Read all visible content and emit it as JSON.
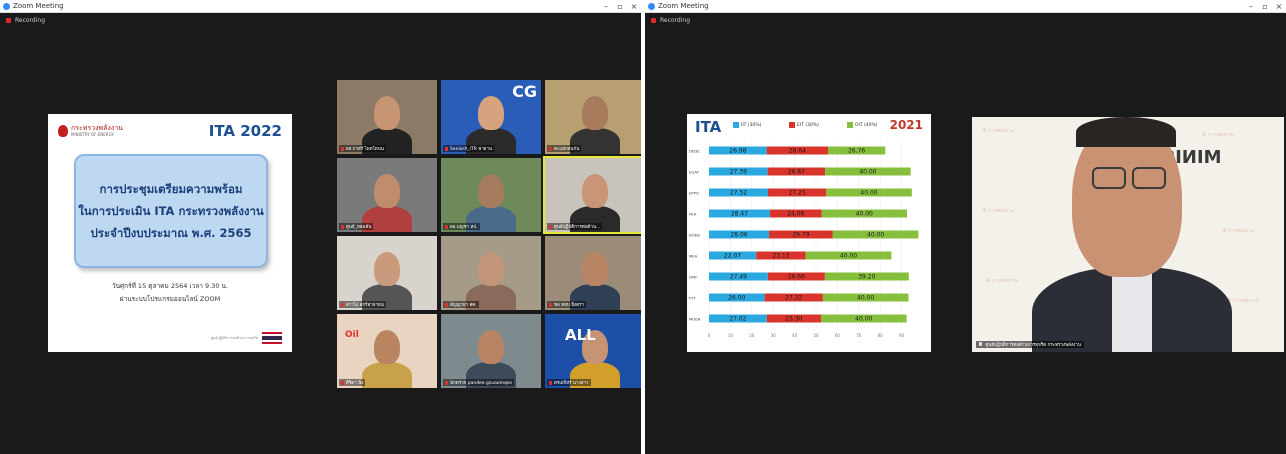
{
  "left_window": {
    "title": "Zoom Meeting",
    "recording": "Recording",
    "slide": {
      "ministry_th": "กระทรวงพลังงาน",
      "ministry_en": "MINISTRY OF ENERGY",
      "ita_label": "ITA 2022",
      "title_lines": [
        "การประชุมเตรียมความพร้อม",
        "ในการประเมิน ITA กระทรวงพลังงาน",
        "ประจำปีงบประมาณ พ.ศ. 2565"
      ],
      "date_line": "วันศุกร์ที่ 15 ตุลาคม 2564  เวลา 9.30 น.",
      "via_line": "ผ่านระบบโปรแกรมออนไลน์ ZOOM",
      "footer": "ศูนย์ปฏิบัติการต่อต้านการทุจริต"
    },
    "participants": [
      {
        "name": "ผอ.กาสร์ ไผทโตนน",
        "bg": "#8a7a66",
        "skin": "#c89574",
        "shirt": "#222222"
      },
      {
        "name": "SeniorA_ITR พ่ายาน",
        "bg": "#2a5db8",
        "skin": "#d7a37e",
        "shirt": "#2b2b2b",
        "overlay": "CG"
      },
      {
        "name": "ตะแลกอนกัน",
        "bg": "#b79f72",
        "skin": "#a77b5c",
        "shirt": "#333333"
      },
      {
        "name": "ศูนย์_ทอมสัน",
        "bg": "#7a7a7a",
        "skin": "#c08d6c",
        "shirt": "#b04040"
      },
      {
        "name": "ผอ.บญชา สป.",
        "bg": "#6e8a5a",
        "skin": "#a47b5d",
        "shirt": "#4a6a8a"
      },
      {
        "name": "ศูนย์ปฏิบัติการต่อต้าน...",
        "bg": "#c9c4bb",
        "skin": "#c99577",
        "shirt": "#2a2a2a",
        "active": true
      },
      {
        "name": "สาวไง สกร้อาจาธน",
        "bg": "#d8d3cd",
        "skin": "#c99b7c",
        "shirt": "#555555"
      },
      {
        "name": "สัญญายา สค.",
        "bg": "#a69a88",
        "skin": "#c3957a",
        "shirt": "#8a6a5a"
      },
      {
        "name": "ชล ทอบ ฮิ่งตรา",
        "bg": "#9a8c78",
        "skin": "#b78564",
        "shirt": "#2f3f55"
      },
      {
        "name": "ศิริดา นิ่ง",
        "bg": "#e8d4c0",
        "skin": "#b98460",
        "shirt": "#c8a14a",
        "overlay": "Oil"
      },
      {
        "name": "นักตรวจ pandee gsuaomqes",
        "bg": "#7e8a8e",
        "skin": "#b78563",
        "shirt": "#3c4a5a"
      },
      {
        "name": "ดรเอกิสร์ นางสาว",
        "bg": "#1e4fa8",
        "skin": "#c69475",
        "shirt": "#d2a02a",
        "overlay": "ALL"
      }
    ]
  },
  "right_window": {
    "title": "Zoom Meeting",
    "recording": "Recording",
    "window_controls": [
      "–",
      "▫",
      "×"
    ],
    "speaker_name": "ศูนย์ปฏิบัติการต่อต้านการทุจริต กระทรวงพลังงาน",
    "chart_data": {
      "type": "bar",
      "title": "ITA",
      "year_label": "2021",
      "stacked": true,
      "orientation": "horizontal",
      "categories": [
        "DEDE",
        "EGAT",
        "EPPO",
        "PEA",
        "DOEB",
        "MEA",
        "DMF",
        "PTT",
        "MOEN"
      ],
      "series": [
        {
          "name": "IIT (30%)",
          "color": "#29a9e0",
          "values": [
            26.98,
            27.39,
            27.52,
            28.47,
            28.06,
            22.07,
            27.49,
            26.0,
            27.02
          ]
        },
        {
          "name": "EIT (30%)",
          "color": "#d9342b",
          "values": [
            28.64,
            26.87,
            27.25,
            24.08,
            29.79,
            23.13,
            26.66,
            27.22,
            25.3
          ]
        },
        {
          "name": "OIT (40%)",
          "color": "#86bf3c",
          "values": [
            26.76,
            40.0,
            40.0,
            40.0,
            40.0,
            40.0,
            39.2,
            40.0,
            40.0
          ]
        }
      ],
      "xticks": [
        "0",
        "10",
        "20",
        "30",
        "40",
        "50",
        "60",
        "70",
        "80",
        "90"
      ],
      "xlim": [
        0,
        100
      ]
    }
  }
}
